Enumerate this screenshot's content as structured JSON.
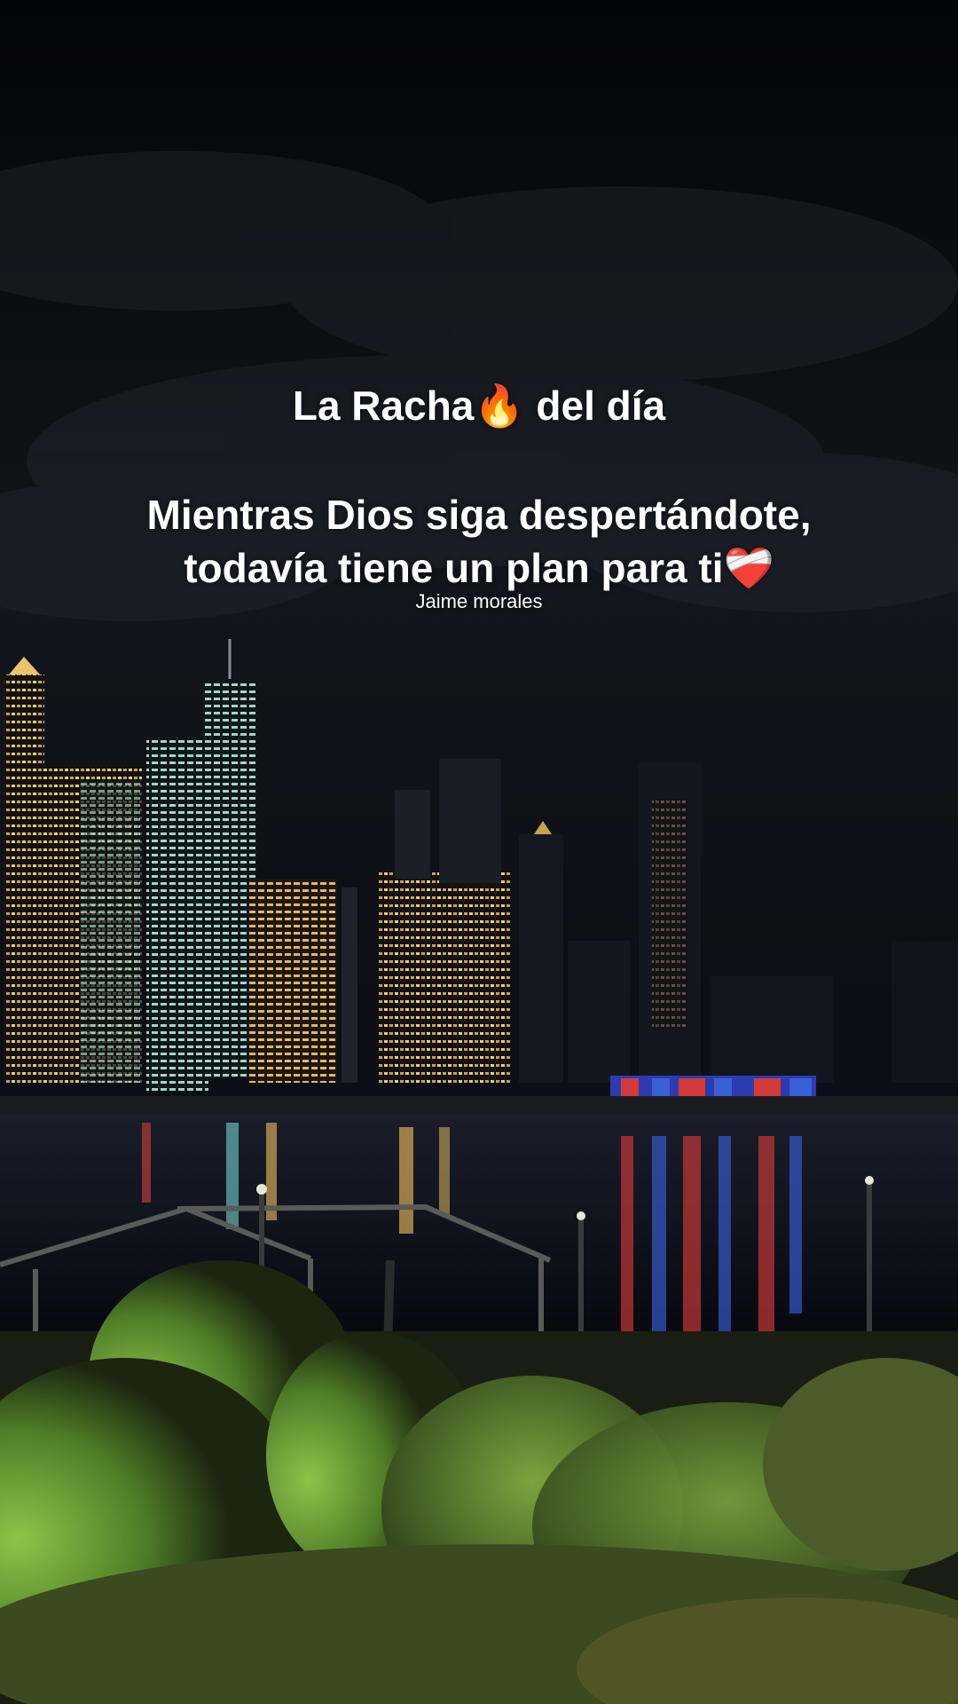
{
  "overlay": {
    "headline": "La Racha🔥 del día",
    "message_line_1": "Mientras Dios siga despertándote,",
    "message_line_2": "todavía tiene un plan para ti❤️‍🩹",
    "author": "Jaime morales"
  },
  "scene": {
    "description_icons": [
      "skyline",
      "river",
      "park-trees",
      "pier-shelter",
      "lamp-post"
    ],
    "colors": {
      "sky": "#0b0d14",
      "water": "#0e1222",
      "foliage": "#6fa83a",
      "window_light": "#f3c46b",
      "red_light": "#d33a3a",
      "blue_light": "#3a5fd6"
    }
  }
}
